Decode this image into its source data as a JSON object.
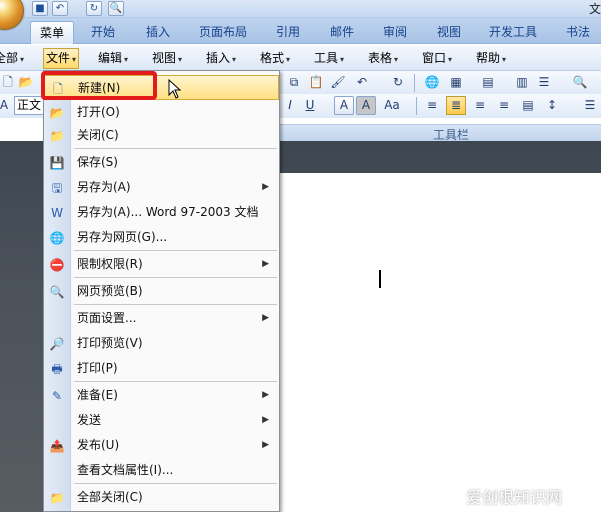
{
  "window": {
    "title_fragment": "文"
  },
  "ribbon_tabs": [
    {
      "label": "菜单",
      "active": true
    },
    {
      "label": "开始"
    },
    {
      "label": "插入"
    },
    {
      "label": "页面布局"
    },
    {
      "label": "引用"
    },
    {
      "label": "邮件"
    },
    {
      "label": "审阅"
    },
    {
      "label": "视图"
    },
    {
      "label": "开发工具"
    },
    {
      "label": "书法"
    }
  ],
  "menubar": [
    {
      "label": "全部"
    },
    {
      "label": "文件"
    },
    {
      "label": "编辑"
    },
    {
      "label": "视图"
    },
    {
      "label": "插入"
    },
    {
      "label": "格式"
    },
    {
      "label": "工具"
    },
    {
      "label": "表格"
    },
    {
      "label": "窗口"
    },
    {
      "label": "帮助"
    }
  ],
  "toolbar": {
    "style_box_value": "正文",
    "group_label": "工具栏",
    "format_buttons": [
      "I",
      "U",
      "A",
      "A",
      "Aa"
    ]
  },
  "file_menu": {
    "items": [
      {
        "label": "新建(N)",
        "icon": "new-document-icon",
        "glyph": "🗋",
        "highlighted": true
      },
      {
        "label": "打开(O)",
        "icon": "open-folder-icon",
        "glyph": "📂"
      },
      {
        "label": "关闭(C)",
        "icon": "close-folder-icon",
        "glyph": "📁"
      },
      {
        "label": "保存(S)",
        "icon": "save-icon",
        "glyph": "💾"
      },
      {
        "label": "另存为(A)",
        "icon": "save-as-icon",
        "glyph": "🖫",
        "submenu": true
      },
      {
        "label": "另存为(A)... Word 97-2003 文档",
        "icon": "word-doc-icon",
        "glyph": "W"
      },
      {
        "label": "另存为网页(G)...",
        "icon": "web-page-icon",
        "glyph": "🌐"
      },
      {
        "label": "限制权限(R)",
        "icon": "permission-icon",
        "glyph": "⛔",
        "submenu": true
      },
      {
        "label": "网页预览(B)",
        "icon": "web-preview-icon",
        "glyph": "🔍"
      },
      {
        "label": "页面设置...",
        "icon": "",
        "glyph": "",
        "submenu": true
      },
      {
        "label": "打印预览(V)",
        "icon": "print-preview-icon",
        "glyph": "🔎"
      },
      {
        "label": "打印(P)",
        "icon": "printer-icon",
        "glyph": "🖶"
      },
      {
        "label": "准备(E)",
        "icon": "prepare-icon",
        "glyph": "✎",
        "submenu": true
      },
      {
        "label": "发送",
        "icon": "",
        "glyph": "",
        "submenu": true
      },
      {
        "label": "发布(U)",
        "icon": "publish-icon",
        "glyph": "📤",
        "submenu": true
      },
      {
        "label": "查看文档属性(I)...",
        "icon": "",
        "glyph": ""
      },
      {
        "label": "全部关闭(C)",
        "icon": "close-all-icon",
        "glyph": "📁"
      }
    ]
  },
  "watermark": "爱创根知识网",
  "colors": {
    "highlight_box": "#e41b1b",
    "menu_hover": "#ffe082"
  }
}
